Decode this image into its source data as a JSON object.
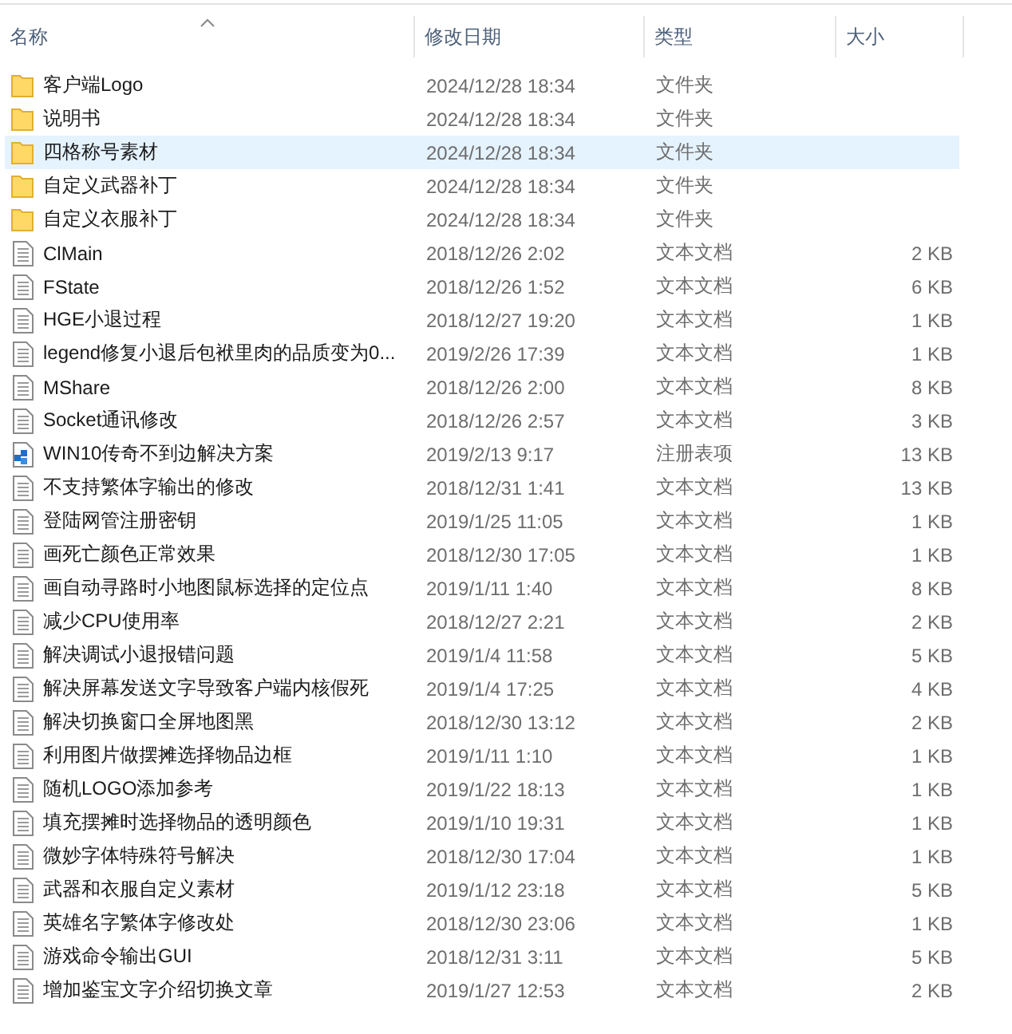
{
  "columns": [
    {
      "label": "名称",
      "sorted": true
    },
    {
      "label": "修改日期",
      "sorted": false
    },
    {
      "label": "类型",
      "sorted": false
    },
    {
      "label": "大小",
      "sorted": false
    }
  ],
  "files": [
    {
      "kind": "folder",
      "name": "客户端Logo",
      "date": "2024/12/28 18:34",
      "type": "文件夹",
      "selected": false
    },
    {
      "kind": "folder",
      "name": "说明书",
      "date": "2024/12/28 18:34",
      "type": "文件夹",
      "selected": false
    },
    {
      "kind": "folder",
      "name": "四格称号素材",
      "date": "2024/12/28 18:34",
      "type": "文件夹",
      "selected": true
    },
    {
      "kind": "folder",
      "name": "自定义武器补丁",
      "date": "2024/12/28 18:34",
      "type": "文件夹",
      "selected": false
    },
    {
      "kind": "folder",
      "name": "自定义衣服补丁",
      "date": "2024/12/28 18:34",
      "type": "文件夹",
      "selected": false
    },
    {
      "kind": "text",
      "name": "ClMain",
      "date": "2018/12/26 2:02",
      "type": "文本文档",
      "size": "2 KB",
      "selected": false
    },
    {
      "kind": "text",
      "name": "FState",
      "date": "2018/12/26 1:52",
      "type": "文本文档",
      "size": "6 KB",
      "selected": false
    },
    {
      "kind": "text",
      "name": "HGE小退过程",
      "date": "2018/12/27 19:20",
      "type": "文本文档",
      "size": "1 KB",
      "selected": false
    },
    {
      "kind": "text",
      "name": "legend修复小退后包袱里肉的品质变为0...",
      "date": "2019/2/26 17:39",
      "type": "文本文档",
      "size": "1 KB",
      "selected": false
    },
    {
      "kind": "text",
      "name": "MShare",
      "date": "2018/12/26 2:00",
      "type": "文本文档",
      "size": "8 KB",
      "selected": false
    },
    {
      "kind": "text",
      "name": "Socket通讯修改",
      "date": "2018/12/26 2:57",
      "type": "文本文档",
      "size": "3 KB",
      "selected": false
    },
    {
      "kind": "registry",
      "name": "WIN10传奇不到边解决方案",
      "date": "2019/2/13 9:17",
      "type": "注册表项",
      "size": "13 KB",
      "selected": false
    },
    {
      "kind": "text",
      "name": "不支持繁体字输出的修改",
      "date": "2018/12/31 1:41",
      "type": "文本文档",
      "size": "13 KB",
      "selected": false
    },
    {
      "kind": "text",
      "name": "登陆网管注册密钥",
      "date": "2019/1/25 11:05",
      "type": "文本文档",
      "size": "1 KB",
      "selected": false
    },
    {
      "kind": "text",
      "name": "画死亡颜色正常效果",
      "date": "2018/12/30 17:05",
      "type": "文本文档",
      "size": "1 KB",
      "selected": false
    },
    {
      "kind": "text",
      "name": "画自动寻路时小地图鼠标选择的定位点",
      "date": "2019/1/11 1:40",
      "type": "文本文档",
      "size": "8 KB",
      "selected": false
    },
    {
      "kind": "text",
      "name": "减少CPU使用率",
      "date": "2018/12/27 2:21",
      "type": "文本文档",
      "size": "2 KB",
      "selected": false
    },
    {
      "kind": "text",
      "name": "解决调试小退报错问题",
      "date": "2019/1/4 11:58",
      "type": "文本文档",
      "size": "5 KB",
      "selected": false
    },
    {
      "kind": "text",
      "name": "解决屏幕发送文字导致客户端内核假死",
      "date": "2019/1/4 17:25",
      "type": "文本文档",
      "size": "4 KB",
      "selected": false
    },
    {
      "kind": "text",
      "name": "解决切换窗口全屏地图黑",
      "date": "2018/12/30 13:12",
      "type": "文本文档",
      "size": "2 KB",
      "selected": false
    },
    {
      "kind": "text",
      "name": "利用图片做摆摊选择物品边框",
      "date": "2019/1/11 1:10",
      "type": "文本文档",
      "size": "1 KB",
      "selected": false
    },
    {
      "kind": "text",
      "name": "随机LOGO添加参考",
      "date": "2019/1/22 18:13",
      "type": "文本文档",
      "size": "1 KB",
      "selected": false
    },
    {
      "kind": "text",
      "name": "填充摆摊时选择物品的透明颜色",
      "date": "2019/1/10 19:31",
      "type": "文本文档",
      "size": "1 KB",
      "selected": false
    },
    {
      "kind": "text",
      "name": "微妙字体特殊符号解决",
      "date": "2018/12/30 17:04",
      "type": "文本文档",
      "size": "1 KB",
      "selected": false
    },
    {
      "kind": "text",
      "name": "武器和衣服自定义素材",
      "date": "2019/1/12 23:18",
      "type": "文本文档",
      "size": "5 KB",
      "selected": false
    },
    {
      "kind": "text",
      "name": "英雄名字繁体字修改处",
      "date": "2018/12/30 23:06",
      "type": "文本文档",
      "size": "1 KB",
      "selected": false
    },
    {
      "kind": "text",
      "name": "游戏命令输出GUI",
      "date": "2018/12/31 3:11",
      "type": "文本文档",
      "size": "5 KB",
      "selected": false
    },
    {
      "kind": "text",
      "name": "增加鉴宝文字介绍切换文章",
      "date": "2019/1/27 12:53",
      "type": "文本文档",
      "size": "2 KB",
      "selected": false
    }
  ]
}
